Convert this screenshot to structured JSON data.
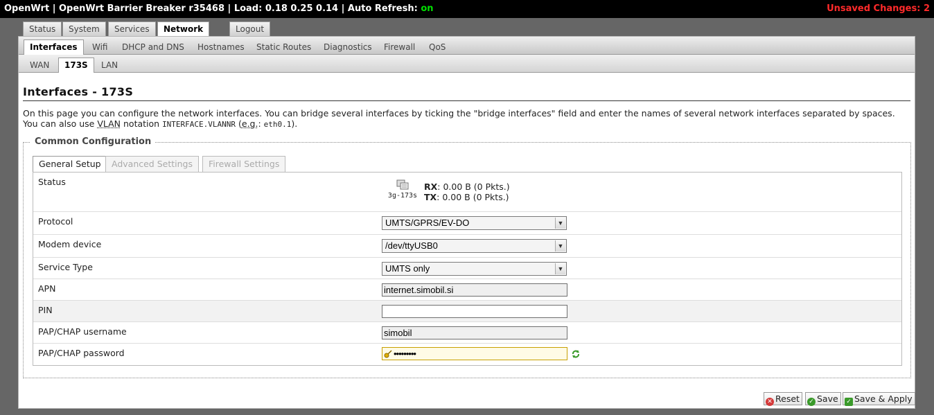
{
  "header": {
    "brand": "OpenWrt",
    "version": "OpenWrt Barrier Breaker r35468",
    "load": "Load: 0.18 0.25 0.14",
    "auto_refresh_label": "Auto Refresh:",
    "auto_refresh_value": "on",
    "unsaved": "Unsaved Changes: 2",
    "sep": "|"
  },
  "main_tabs": [
    "Status",
    "System",
    "Services",
    "Network",
    "Logout"
  ],
  "sub_tabs": [
    "Interfaces",
    "Wifi",
    "DHCP and DNS",
    "Hostnames",
    "Static Routes",
    "Diagnostics",
    "Firewall",
    "QoS"
  ],
  "iface_tabs": [
    "WAN",
    "173S",
    "LAN"
  ],
  "page": {
    "title": "Interfaces - 173S",
    "desc_line1": "On this page you can configure the network interfaces. You can bridge several interfaces by ticking the \"bridge interfaces\" field and enter the names of several network interfaces separated by spaces.",
    "desc_line2_a": "You can also use ",
    "desc_vlan": "VLAN",
    "desc_line2_b": " notation ",
    "desc_code1": "INTERFACE.VLANNR",
    "desc_line2_c": " (",
    "desc_eg": "e.g.",
    "desc_line2_d": ": ",
    "desc_code2": "eth0.1",
    "desc_line2_e": ")."
  },
  "config": {
    "legend": "Common Configuration",
    "tabs": [
      "General Setup",
      "Advanced Settings",
      "Firewall Settings"
    ],
    "status_label": "Status",
    "status_device": "3g-173s",
    "rx_label": "RX",
    "rx_value": ": 0.00 B (0 Pkts.)",
    "tx_label": "TX",
    "tx_value": ": 0.00 B (0 Pkts.)",
    "protocol_label": "Protocol",
    "protocol_value": "UMTS/GPRS/EV-DO",
    "modem_label": "Modem device",
    "modem_value": "/dev/ttyUSB0",
    "service_label": "Service Type",
    "service_value": "UMTS only",
    "apn_label": "APN",
    "apn_value": "internet.simobil.si",
    "pin_label": "PIN",
    "pin_value": "",
    "user_label": "PAP/CHAP username",
    "user_value": "simobil",
    "pass_label": "PAP/CHAP password",
    "pass_value": "•••••••••"
  },
  "buttons": {
    "reset": "Reset",
    "save": "Save",
    "save_apply": "Save & Apply"
  },
  "colors": {
    "accent_red": "#ff2a2a",
    "accent_green": "#00e000"
  }
}
